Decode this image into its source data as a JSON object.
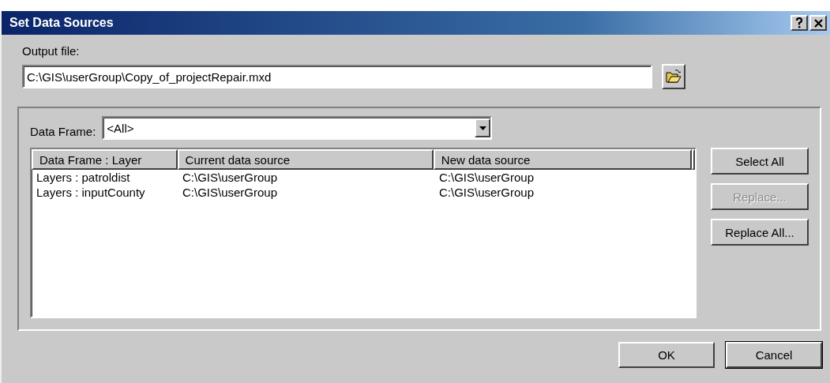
{
  "window": {
    "title": "Set Data Sources"
  },
  "output_file": {
    "label": "Output file:",
    "value": "C:\\GIS\\userGroup\\Copy_of_projectRepair.mxd"
  },
  "data_frame": {
    "label": "Data Frame:",
    "value": "<All>"
  },
  "table": {
    "columns": [
      "Data Frame : Layer",
      "Current data source",
      "New data source"
    ],
    "rows": [
      {
        "cells": [
          "Layers : patroldist",
          "C:\\GIS\\userGroup",
          "C:\\GIS\\userGroup"
        ]
      },
      {
        "cells": [
          "Layers : inputCounty",
          "C:\\GIS\\userGroup",
          "C:\\GIS\\userGroup"
        ]
      }
    ]
  },
  "side_buttons": [
    {
      "label": "Select All",
      "disabled": false
    },
    {
      "label": "Replace...",
      "disabled": true
    },
    {
      "label": "Replace All...",
      "disabled": false
    }
  ],
  "buttons": [
    {
      "label": "OK",
      "default": false
    },
    {
      "label": "Cancel",
      "default": true
    }
  ]
}
